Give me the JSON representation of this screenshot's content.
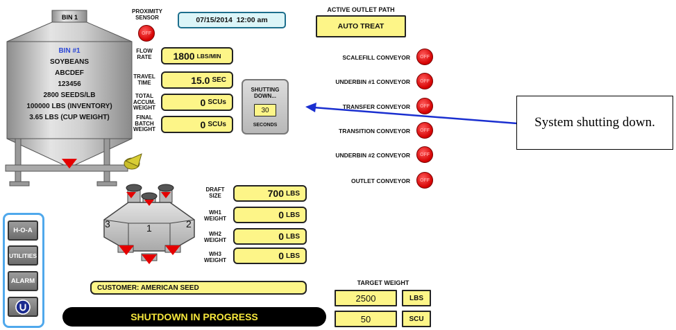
{
  "bin": {
    "tab_label": "BIN 1",
    "lines": [
      "BIN #1",
      "SOYBEANS",
      "ABCDEF",
      "123456",
      "2800 SEEDS/LB",
      "100000 LBS (INVENTORY)",
      "3.65 LBS (CUP WEIGHT)"
    ]
  },
  "proximity": {
    "label": "PROXIMITY SENSOR",
    "state": "OFF"
  },
  "datetime": "07/15/2014  12:00 am",
  "outlet_path": {
    "title": "ACTIVE OUTLET PATH",
    "value": "AUTO TREAT"
  },
  "flow_rate": {
    "label": "FLOW RATE",
    "value": "1800",
    "unit": "LBS/MIN"
  },
  "travel_time": {
    "label": "TRAVEL TIME",
    "value": "15.0",
    "unit": "SEC"
  },
  "total_accum": {
    "label": "TOTAL ACCUM. WEIGHT",
    "value": "0",
    "unit": "SCUs"
  },
  "final_batch": {
    "label": "FINAL BATCH WEIGHT",
    "value": "0",
    "unit": "SCUs"
  },
  "shutdown_panel": {
    "title": "SHUTTING DOWN...",
    "seconds_value": "30",
    "seconds_label": "SECONDS"
  },
  "conveyors": [
    {
      "name": "SCALEFILL CONVEYOR",
      "state": "OFF"
    },
    {
      "name": "UNDERBIN #1 CONVEYOR",
      "state": "OFF"
    },
    {
      "name": "TRANSFER CONVEYOR",
      "state": "OFF"
    },
    {
      "name": "TRANSITION CONVEYOR",
      "state": "OFF"
    },
    {
      "name": "UNDERBIN #2 CONVEYOR",
      "state": "OFF"
    },
    {
      "name": "OUTLET CONVEYOR",
      "state": "OFF"
    }
  ],
  "hopper": {
    "sections": [
      "3",
      "1",
      "2"
    ]
  },
  "draft": {
    "draft_size": {
      "label": "DRAFT SIZE",
      "value": "700",
      "unit": "LBS"
    },
    "wh1": {
      "label": "WH1 WEIGHT",
      "value": "0",
      "unit": "LBS"
    },
    "wh2": {
      "label": "WH2 WEIGHT",
      "value": "0",
      "unit": "LBS"
    },
    "wh3": {
      "label": "WH3 WEIGHT",
      "value": "0",
      "unit": "LBS"
    }
  },
  "nav": {
    "hoa": "H-O-A",
    "utilities": "UTILITIES",
    "alarm": "ALARM"
  },
  "customer": "CUSTOMER: AMERICAN SEED",
  "status_bar": "SHUTDOWN IN PROGRESS",
  "target_weight": {
    "title": "TARGET WEIGHT",
    "lbs_value": "2500",
    "lbs_unit": "LBS",
    "scu_value": "50",
    "scu_unit": "SCU"
  },
  "callout": "System shutting down.",
  "colors": {
    "display_yellow": "#fdf588",
    "indicator_red": "#e40000",
    "arrow_blue": "#1a2fd0",
    "status_bar_bg": "#000000",
    "status_text": "#f7e83c"
  }
}
